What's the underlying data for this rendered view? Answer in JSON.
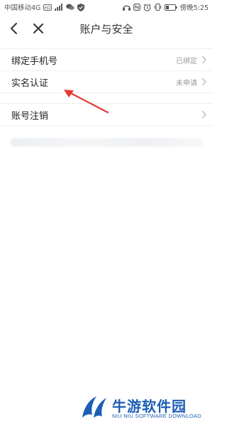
{
  "status_bar": {
    "carrier": "中国移动4G",
    "hd_badge": "HD",
    "time": "傍晚5:25",
    "icons": [
      "hd-icon",
      "signal-icon",
      "wechat-icon",
      "shield-icon",
      "headset-icon",
      "nfc-icon",
      "alarm-icon",
      "vibrate-icon",
      "battery-icon"
    ]
  },
  "header": {
    "title": "账户与安全",
    "back_icon": "chevron-left-icon",
    "close_icon": "close-icon"
  },
  "settings": {
    "items": [
      {
        "label": "绑定手机号",
        "value": "已绑定"
      },
      {
        "label": "实名认证",
        "value": "未申请"
      },
      {
        "label": "账号注销",
        "value": ""
      }
    ]
  },
  "watermark": {
    "title": "牛游软件园",
    "subtitle": "NIU NIU SOFTWARE DOWNLOAD"
  },
  "colors": {
    "annotation_arrow": "#e53935",
    "watermark": "#1c5fb5"
  }
}
